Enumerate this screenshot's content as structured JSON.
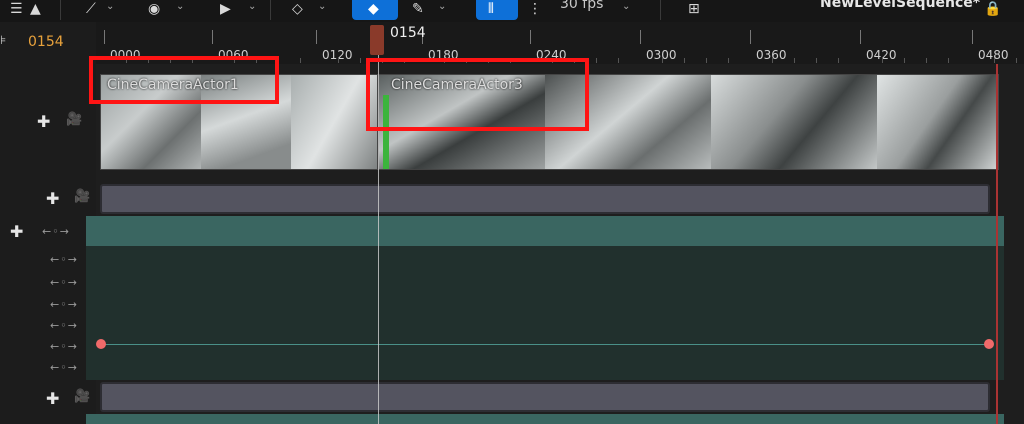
{
  "toolbar": {
    "fps_label": "30 fps",
    "sequence_title": "NewLevelSequence*"
  },
  "timeline": {
    "current_frame": "0154",
    "playhead_label": "0154",
    "ruler_ticks": [
      "0000",
      "0060",
      "0120",
      "0180",
      "0240",
      "0300",
      "0360",
      "0420",
      "0480"
    ]
  },
  "shots": [
    {
      "label": "CineCameraActor1"
    },
    {
      "label": "CineCameraActor3"
    }
  ],
  "colors": {
    "accent_active": "#0e70d8",
    "frame_text": "#e8a23c",
    "highlight": "#ff1414",
    "key": "#f06a6a"
  }
}
